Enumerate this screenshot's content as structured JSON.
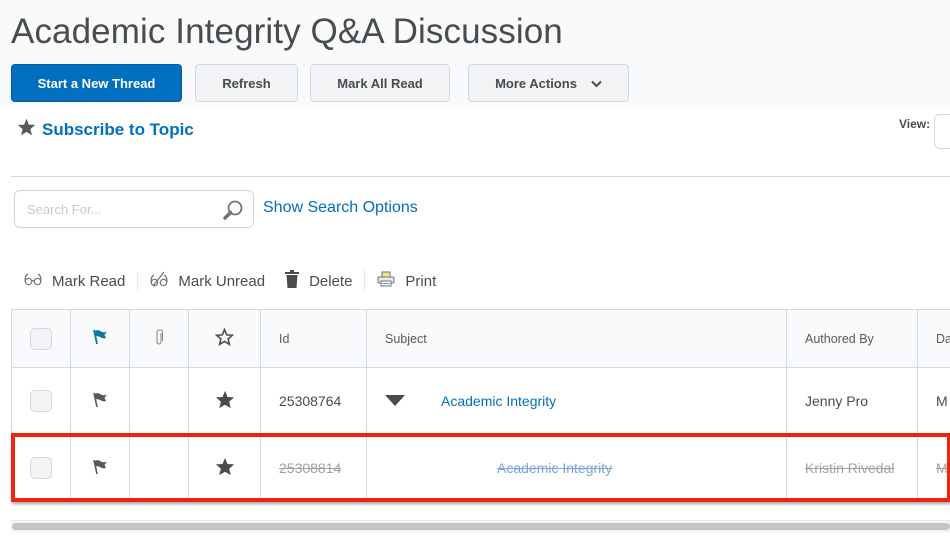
{
  "page": {
    "title": "Academic Integrity Q&A Discussion"
  },
  "toolbar": {
    "start_thread": "Start a New Thread",
    "refresh": "Refresh",
    "mark_all_read": "Mark All Read",
    "more_actions": "More Actions"
  },
  "subscribe": {
    "label": "Subscribe to Topic",
    "icon": "star-icon"
  },
  "view": {
    "label": "View:"
  },
  "search": {
    "placeholder": "Search For...",
    "value": "",
    "show_options": "Show Search Options"
  },
  "bulk_actions": [
    {
      "label": "Mark Read",
      "icon": "glasses-icon"
    },
    {
      "label": "Mark Unread",
      "icon": "glasses-crossed-icon"
    },
    {
      "label": "Delete",
      "icon": "trash-icon"
    },
    {
      "label": "Print",
      "icon": "printer-icon"
    }
  ],
  "table": {
    "columns": {
      "select": "",
      "flag": "flag-icon",
      "attachment": "paperclip-icon",
      "favorite": "star-outline-icon",
      "id": "Id",
      "subject": "Subject",
      "author": "Authored By",
      "date": "Da"
    },
    "rows": [
      {
        "id": "25308764",
        "subject": "Academic Integrity",
        "author": "Jenny Pro",
        "date": "M",
        "expanded": true,
        "deleted": false
      },
      {
        "id": "25308814",
        "subject": "Academic Integrity",
        "author": "Kristin Rivedal",
        "date": "M",
        "expanded": false,
        "deleted": true
      }
    ]
  },
  "colors": {
    "primary": "#006fbf",
    "flag_header": "#0a7a96",
    "highlight": "#f0230f"
  }
}
